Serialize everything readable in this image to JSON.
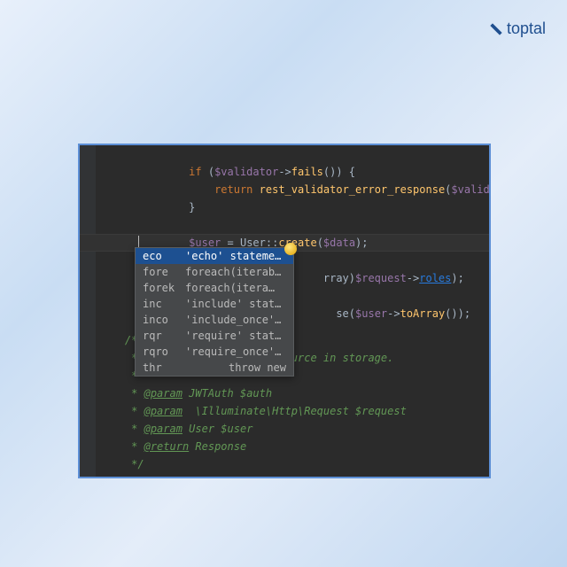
{
  "brand": {
    "name": "toptal"
  },
  "code": {
    "l1_if": "if",
    "l1_var": "$validator",
    "l1_rest": "->",
    "l1_fn": "fails",
    "l1_end": "()) {",
    "l2_return": "return",
    "l2_fn": "rest_validator_error_response",
    "l2_open": "(",
    "l2_var": "$validator",
    "l2_close": ");",
    "l3": "}",
    "l5_var": "$user",
    "l5_eq": " = ",
    "l5_cls": "User::",
    "l5_fn": "create",
    "l5_open": "(",
    "l5_arg": "$data",
    "l5_close": ");",
    "l7_tail_a": "rray)",
    "l7_req": "$request",
    "l7_arrow": "->",
    "l7_roles": "roles",
    "l7_end": ");",
    "l9_tail_a": "se(",
    "l9_user": "$user",
    "l9_arrow": "->",
    "l9_fn": "toArray",
    "l9_end": "());",
    "l10": "}",
    "d1": "/**",
    "d2_a": " * ",
    "d2_b": "urce in storage.",
    "d3": " *",
    "d4_star": " * ",
    "d4_tag": "@param",
    "d4_rest": " JWTAuth $auth",
    "d5_star": " * ",
    "d5_tag": "@param",
    "d5_rest": "  \\Illuminate\\Http\\Request $request",
    "d6_star": " * ",
    "d6_tag": "@param",
    "d6_rest": " User $user",
    "d7_star": " * ",
    "d7_tag": "@return",
    "d7_rest": " Response",
    "d8": " */"
  },
  "autocomplete": {
    "items": [
      {
        "abbr": "eco",
        "desc": "'echo' statement"
      },
      {
        "abbr": "fore",
        "desc": "foreach(iterab…"
      },
      {
        "abbr": "forek",
        "desc": "foreach(itera…"
      },
      {
        "abbr": "inc",
        "desc": "'include' state…"
      },
      {
        "abbr": "inco",
        "desc": "'include_once'…"
      },
      {
        "abbr": "rqr",
        "desc": "'require' state…"
      },
      {
        "abbr": "rqro",
        "desc": "'require_once'…"
      },
      {
        "abbr": "thr",
        "desc": "throw new"
      }
    ]
  }
}
